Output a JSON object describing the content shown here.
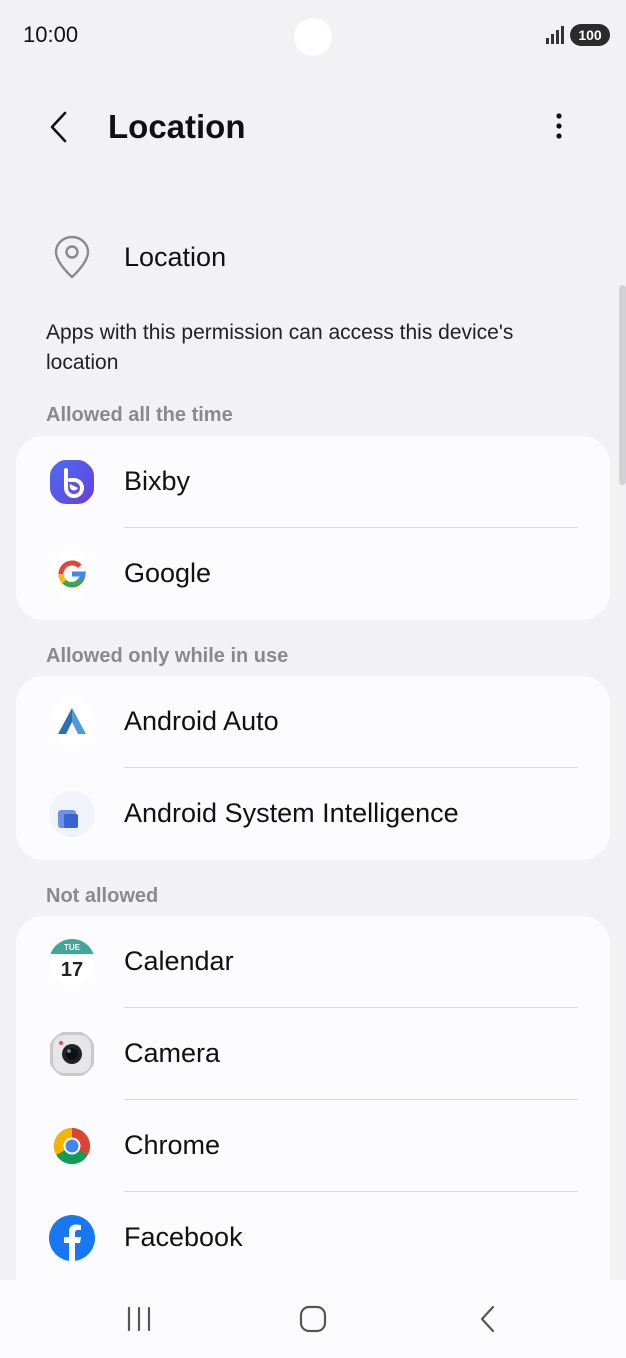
{
  "status_bar": {
    "time": "10:00",
    "battery": "100"
  },
  "header": {
    "title": "Location"
  },
  "permission": {
    "label": "Location",
    "description": "Apps with this permission can access this device's location"
  },
  "sections": {
    "allowed_all_time": {
      "title": "Allowed all the time",
      "apps": [
        {
          "label": "Bixby"
        },
        {
          "label": "Google"
        }
      ]
    },
    "allowed_while_in_use": {
      "title": "Allowed only while in use",
      "apps": [
        {
          "label": "Android Auto"
        },
        {
          "label": "Android System Intelligence"
        }
      ]
    },
    "not_allowed": {
      "title": "Not allowed",
      "apps": [
        {
          "label": "Calendar"
        },
        {
          "label": "Camera"
        },
        {
          "label": "Chrome"
        },
        {
          "label": "Facebook"
        }
      ]
    }
  },
  "calendar_icon": {
    "day": "TUE",
    "date": "17"
  },
  "colors": {
    "background": "#f2f2f4",
    "card": "#fcfcfe",
    "section_title": "#8a8a8e",
    "bixby": "#3b55e6",
    "facebook": "#1877f2"
  }
}
